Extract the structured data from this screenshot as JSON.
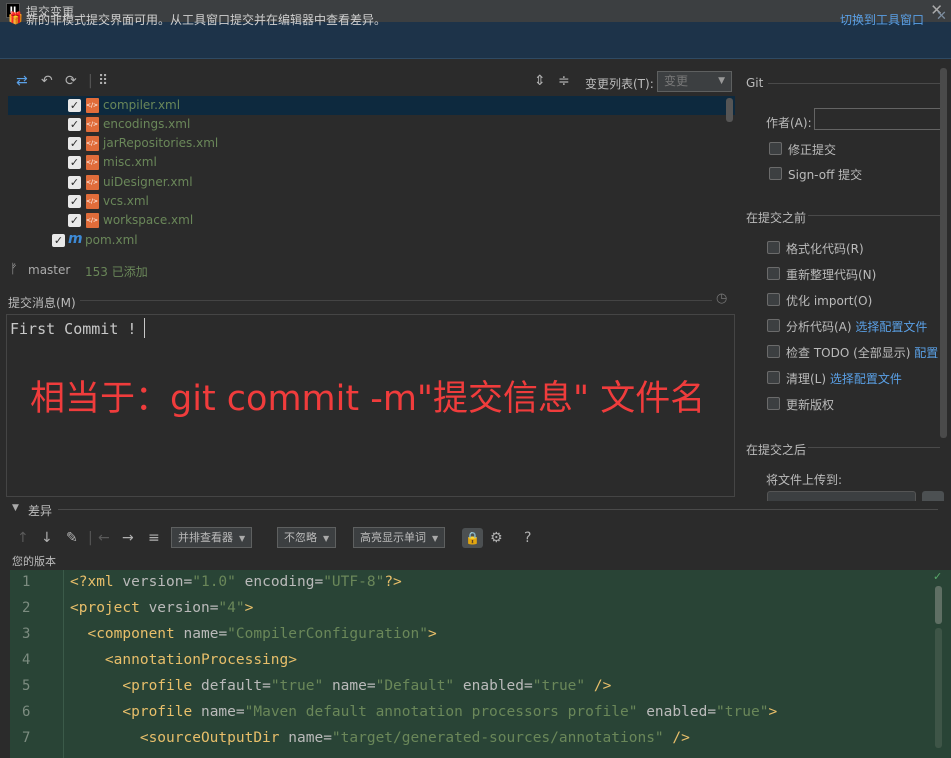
{
  "titlebar": {
    "logo": "IJ",
    "title": "提交变更",
    "close": "✕"
  },
  "banner": {
    "icon": "gift-icon",
    "text": "新的非模式提交界面可用。从工具窗口提交并在编辑器中查看差异。",
    "link": "切换到工具窗口",
    "close": "✕"
  },
  "toolbar": {
    "changelist_label": "变更列表(T):",
    "changelist_value": "变更"
  },
  "tree": {
    "items": [
      {
        "name": "compiler.xml",
        "checked": true,
        "type": "xml",
        "selected": true
      },
      {
        "name": "encodings.xml",
        "checked": true,
        "type": "xml"
      },
      {
        "name": "jarRepositories.xml",
        "checked": true,
        "type": "xml"
      },
      {
        "name": "misc.xml",
        "checked": true,
        "type": "xml"
      },
      {
        "name": "uiDesigner.xml",
        "checked": true,
        "type": "xml"
      },
      {
        "name": "vcs.xml",
        "checked": true,
        "type": "xml"
      },
      {
        "name": "workspace.xml",
        "checked": true,
        "type": "xml"
      },
      {
        "name": "pom.xml",
        "checked": true,
        "type": "maven"
      }
    ]
  },
  "branch": {
    "name": "master",
    "added": "153 已添加"
  },
  "commit": {
    "label": "提交消息(M)",
    "message": "First Commit !",
    "annotation": "相当于：git commit -m\"提交信息\" 文件名"
  },
  "right": {
    "git_label": "Git",
    "author_label": "作者(A):",
    "amend": "修正提交",
    "signoff": "Sign-off 提交",
    "before_label": "在提交之前",
    "before_options": [
      {
        "label": "格式化代码(R)"
      },
      {
        "label": "重新整理代码(N)"
      },
      {
        "label": "优化 import(O)"
      },
      {
        "label": "分析代码(A)",
        "link": "选择配置文件"
      },
      {
        "label": "检查 TODO (全部显示)",
        "link": "配置"
      },
      {
        "label": "清理(L)",
        "link": "选择配置文件"
      },
      {
        "label": "更新版权"
      }
    ],
    "after_label": "在提交之后",
    "upload_label": "将文件上传到:"
  },
  "diff": {
    "label": "差异",
    "viewer_combo": "并排查看器",
    "ignore_combo": "不忽略",
    "highlight_combo": "高亮显示单词",
    "help": "?",
    "version_label": "您的版本",
    "lines": [
      {
        "n": "1",
        "text": "<?xml version=\"1.0\" encoding=\"UTF-8\"?>"
      },
      {
        "n": "2",
        "text": "<project version=\"4\">"
      },
      {
        "n": "3",
        "text": "  <component name=\"CompilerConfiguration\">"
      },
      {
        "n": "4",
        "text": "    <annotationProcessing>"
      },
      {
        "n": "5",
        "text": "      <profile default=\"true\" name=\"Default\" enabled=\"true\" />"
      },
      {
        "n": "6",
        "text": "      <profile name=\"Maven default annotation processors profile\" enabled=\"true\">"
      },
      {
        "n": "7",
        "text": "        <sourceOutputDir name=\"target/generated-sources/annotations\" />"
      }
    ]
  }
}
